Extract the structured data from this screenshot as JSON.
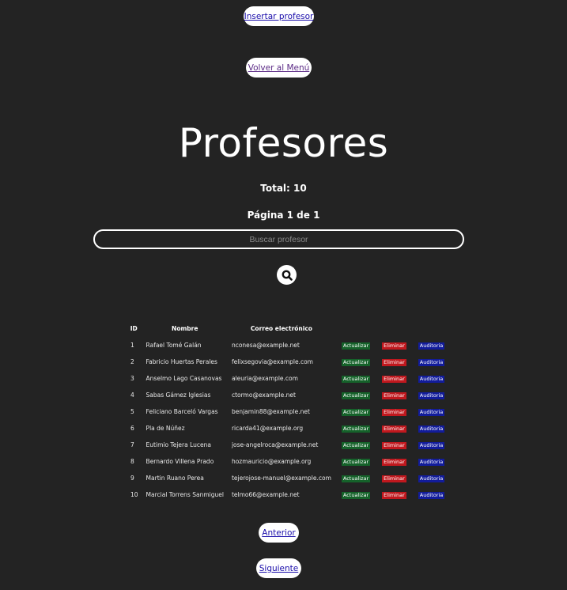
{
  "nav": {
    "insert_label": "Insertar profesor",
    "back_label": "Volver al Menú"
  },
  "header": {
    "title": "Profesores",
    "total": "Total: 10",
    "page": "Página 1 de 1"
  },
  "search": {
    "placeholder": "Buscar profesor",
    "value": "",
    "icon": "search-icon"
  },
  "table": {
    "columns": [
      "ID",
      "Nombre",
      "Correo electrónico",
      ""
    ],
    "action_labels": {
      "update": "Actualizar",
      "delete": "Eliminar",
      "audit": "Auditoria"
    },
    "rows": [
      {
        "id": "1",
        "nombre": "Rafael Tomé Galán",
        "correo": "nconesa@example.net"
      },
      {
        "id": "2",
        "nombre": "Fabricio Huertas Perales",
        "correo": "felixsegovia@example.com"
      },
      {
        "id": "3",
        "nombre": "Anselmo Lago Casanovas",
        "correo": "aleuria@example.com"
      },
      {
        "id": "4",
        "nombre": "Sabas Gámez Iglesias",
        "correo": "ctormo@example.net"
      },
      {
        "id": "5",
        "nombre": "Feliciano Barceló Vargas",
        "correo": "benjamin88@example.net"
      },
      {
        "id": "6",
        "nombre": "Pla de Núñez",
        "correo": "ricarda41@example.org"
      },
      {
        "id": "7",
        "nombre": "Eutimio Tejera Lucena",
        "correo": "jose-angelroca@example.net"
      },
      {
        "id": "8",
        "nombre": "Bernardo Villena Prado",
        "correo": "hozmauricio@example.org"
      },
      {
        "id": "9",
        "nombre": "Martin Ruano Perea",
        "correo": "tejerojose-manuel@example.com"
      },
      {
        "id": "10",
        "nombre": "Marcial Torrens Sanmiguel",
        "correo": "telmo66@example.net"
      }
    ]
  },
  "pagination": {
    "prev_label": "Anterior",
    "next_label": "Siguiente"
  },
  "colors": {
    "background": "#232323",
    "update_badge": "#15622a",
    "delete_badge": "#c0181e",
    "audit_badge": "#121c9b"
  }
}
